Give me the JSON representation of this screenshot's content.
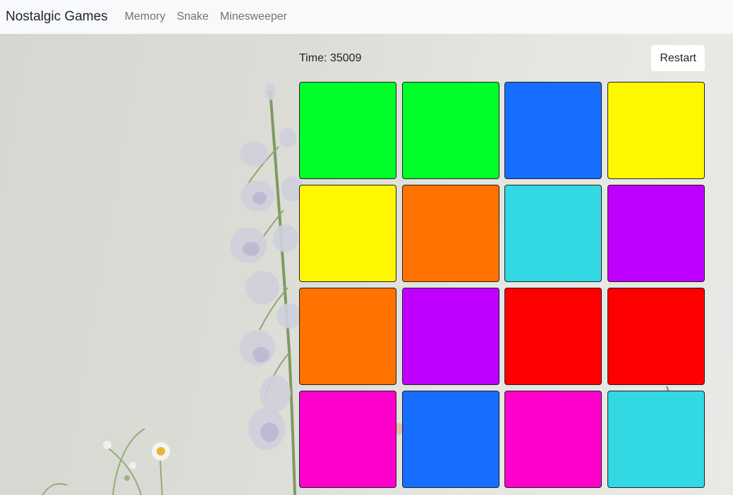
{
  "navbar": {
    "brand": "Nostalgic Games",
    "links": [
      "Memory",
      "Snake",
      "Minesweeper"
    ]
  },
  "game": {
    "timer_label": "Time: 35009",
    "restart_label": "Restart",
    "tiles": [
      "#00ff2a",
      "#00ff2a",
      "#166dff",
      "#fff700",
      "#fff700",
      "#ff7200",
      "#32d8e2",
      "#bf00ff",
      "#ff7200",
      "#bf00ff",
      "#ff0000",
      "#ff0000",
      "#ff00cc",
      "#166dff",
      "#ff00cc",
      "#32d8e2"
    ]
  }
}
